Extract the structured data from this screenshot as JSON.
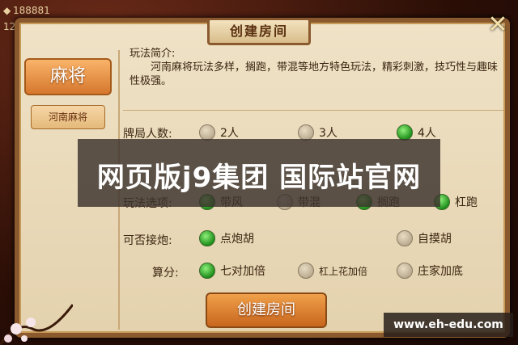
{
  "top_bar": {
    "coins": "188881",
    "level": "12"
  },
  "title": "创建房间",
  "sidebar": {
    "main_label": "麻将",
    "sub_label": "河南麻将"
  },
  "intro": {
    "heading": "玩法简介:",
    "body": "河南麻将玩法多样，搁跑，带混等地方特色玩法，精彩刺激，技巧性与趣味性极强。"
  },
  "rows": {
    "players": {
      "label": "牌局人数:",
      "options": [
        "2人",
        "3人",
        "4人"
      ],
      "selected": "4人"
    },
    "play_options": {
      "label": "玩法选项:",
      "options": [
        "带风",
        "带混",
        "搁跑",
        "杠跑"
      ],
      "selected": [
        "带风",
        "搁跑",
        "杠跑"
      ]
    },
    "discard_win": {
      "label": "可否接炮:",
      "options": [
        "点炮胡",
        "自摸胡"
      ],
      "selected": "点炮胡"
    },
    "scoring": {
      "label": "算分:",
      "options": [
        "七对加倍",
        "杠上花加倍",
        "庄家加底"
      ],
      "selected": [
        "七对加倍"
      ]
    }
  },
  "create_button": "创建房间",
  "watermark": "网页版j9集团 国际站官网",
  "site_tag": "www.eh-edu.com",
  "colors": {
    "panel": "#efe2c6",
    "frame": "#8a5a2e",
    "accent_orange": "#d6782e",
    "radio_on": "#1f8e1a"
  }
}
